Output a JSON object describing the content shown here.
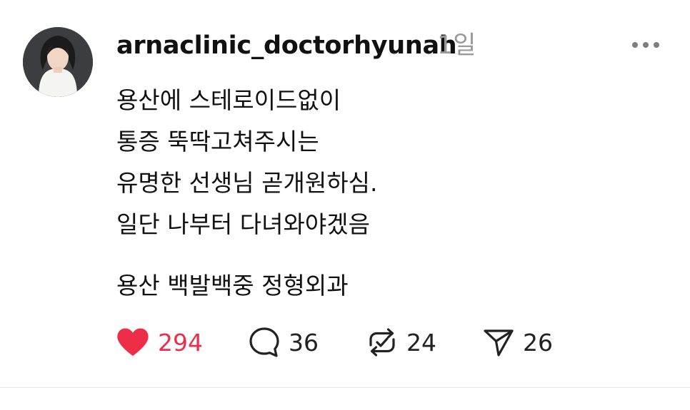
{
  "post": {
    "avatar_icon": "profile-photo",
    "username": "arnaclinic_doctorhyunah",
    "timestamp": "1일",
    "lines": [
      "용산에 스테로이드없이",
      "통증 뚝딱고쳐주시는",
      "유명한 선생님 곧개원하심.",
      "일단 나부터 다녀와야겠음",
      "용산 백발백중 정형외과"
    ],
    "actions": {
      "like": {
        "icon": "heart-icon",
        "count": "294",
        "color": "#ee2d49"
      },
      "comment": {
        "icon": "comment-bubble-icon",
        "count": "36"
      },
      "repost": {
        "icon": "repost-icon",
        "count": "24"
      },
      "share": {
        "icon": "send-icon",
        "count": "26"
      }
    }
  }
}
